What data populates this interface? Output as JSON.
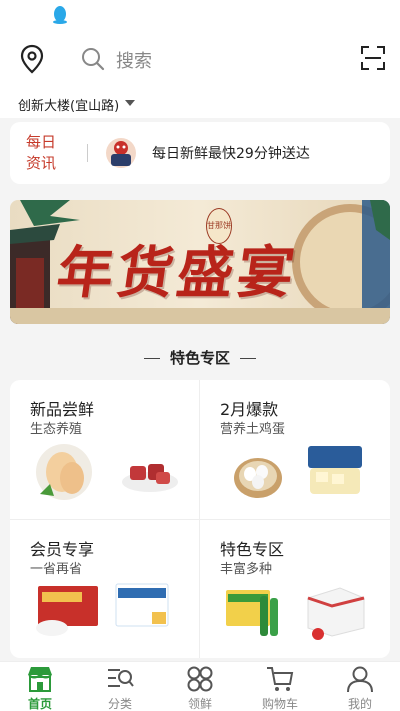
{
  "search": {
    "placeholder": "搜索"
  },
  "address": {
    "text": "创新大楼(宜山路)"
  },
  "news": {
    "title": "每日资讯",
    "headline": "每日新鲜最快29分钟送达"
  },
  "banner": {
    "title": "年货盛宴",
    "stamp_text": "甘那饼"
  },
  "section": {
    "title": "特色专区"
  },
  "categories": [
    {
      "title": "新品尝鲜",
      "subtitle": "生态养殖"
    },
    {
      "title": "2月爆款",
      "subtitle": "营养土鸡蛋"
    },
    {
      "title": "会员专享",
      "subtitle": "一省再省"
    },
    {
      "title": "特色专区",
      "subtitle": "丰富多种"
    }
  ],
  "tabs": [
    {
      "label": "首页",
      "icon": "home-store-icon",
      "active": true
    },
    {
      "label": "分类",
      "icon": "category-search-icon"
    },
    {
      "label": "领鲜",
      "icon": "grid-flower-icon"
    },
    {
      "label": "购物车",
      "icon": "cart-icon"
    },
    {
      "label": "我的",
      "icon": "profile-icon"
    }
  ],
  "colors": {
    "accent_green": "#2b9a3a",
    "news_red": "#c63b2b",
    "banner_red": "#b8241a"
  }
}
